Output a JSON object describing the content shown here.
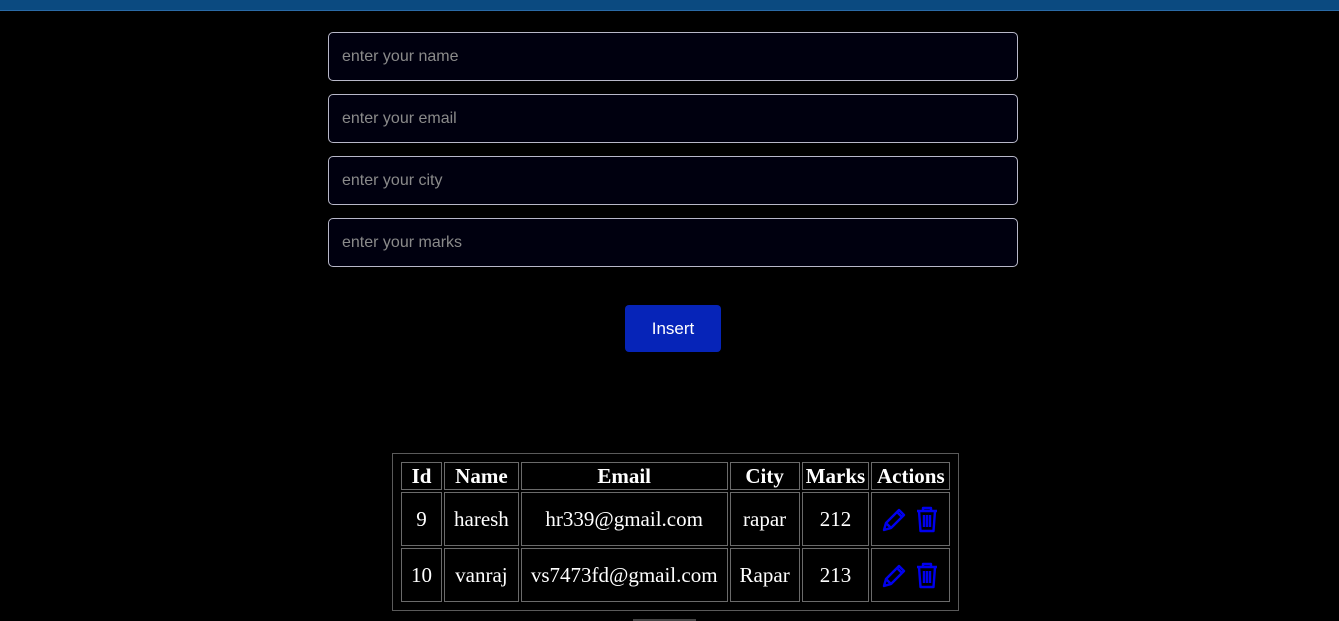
{
  "form": {
    "name_placeholder": "enter your name",
    "email_placeholder": "enter your email",
    "city_placeholder": "enter your city",
    "marks_placeholder": "enter your marks",
    "insert_label": "Insert"
  },
  "table": {
    "headers": [
      "Id",
      "Name",
      "Email",
      "City",
      "Marks",
      "Actions"
    ],
    "rows": [
      {
        "id": "9",
        "name": "haresh",
        "email": "hr339@gmail.com",
        "city": "rapar",
        "marks": "212"
      },
      {
        "id": "10",
        "name": "vanraj",
        "email": "vs7473fd@gmail.com",
        "city": "Rapar",
        "marks": "213"
      }
    ]
  },
  "colors": {
    "top_bar": "#0b4a80",
    "button": "#0624b8",
    "icon": "#0000ee"
  },
  "icons": {
    "edit": "pencil-icon",
    "delete": "trash-icon"
  }
}
